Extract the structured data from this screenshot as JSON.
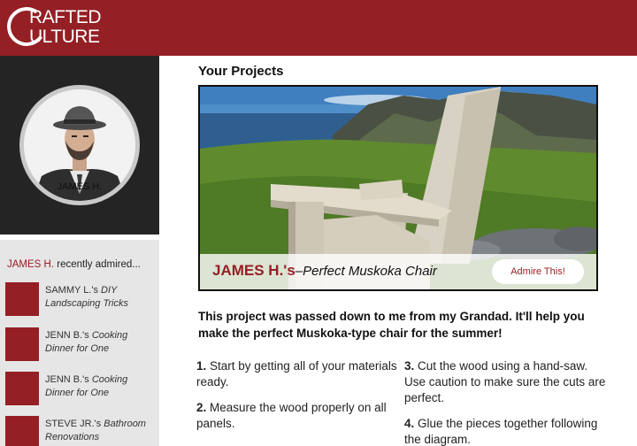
{
  "brand": {
    "line1": "RAFTED",
    "line2": "ULTURE",
    "color": "#941f24"
  },
  "profile": {
    "name": "JAMES H."
  },
  "sidebar": {
    "heading_name": "JAMES H.",
    "heading_text": " recently admired...",
    "items": [
      {
        "owner": "SAMMY L.'s ",
        "title_first": "DIY",
        "title_rest": "Landscaping Tricks"
      },
      {
        "owner": "JENN B.'s ",
        "title_first": "Cooking",
        "title_rest": "Dinner for One"
      },
      {
        "owner": "JENN B.'s ",
        "title_first": "Cooking",
        "title_rest": "Dinner for One"
      },
      {
        "owner": "STEVE JR.'s ",
        "title_first": "Bathroom",
        "title_rest": "Renovations"
      }
    ]
  },
  "main": {
    "title": "Your Projects",
    "project": {
      "owner": "JAMES H.'s",
      "title": "–Perfect Muskoka Chair",
      "admire_label": "Admire This!"
    },
    "intro": "This project was passed down to me from my Grandad. It'll help you make the perfect Muskoka-type chair for the summer!",
    "steps": [
      {
        "num": "1.",
        "text": " Start by getting all of your materials ready."
      },
      {
        "num": "2.",
        "text": " Measure the wood properly on all panels."
      },
      {
        "num": "3.",
        "text": " Cut the wood using a hand-saw. Use caution to make sure the cuts are perfect."
      },
      {
        "num": "4.",
        "text": " Glue the pieces together following the diagram."
      }
    ]
  }
}
